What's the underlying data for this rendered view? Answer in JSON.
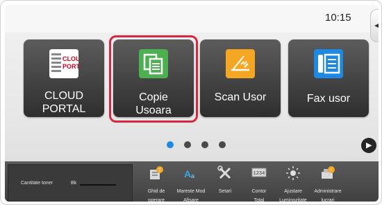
{
  "status": {
    "time": "10:15",
    "side_tab_icon": "collapse-arrow"
  },
  "tiles": [
    {
      "label": "CLOUD PORTAL",
      "icon": "cloud-portal-icon",
      "logo_lines": [
        "CLOUD",
        "PORTAL"
      ]
    },
    {
      "label_lines": [
        "Copie",
        "Usoara"
      ],
      "icon": "copy-icon",
      "color": "#4caf50",
      "selected": true
    },
    {
      "label": "Scan Usor",
      "icon": "scan-icon",
      "color": "#f5a623"
    },
    {
      "label": "Fax usor",
      "icon": "fax-icon",
      "color": "#1e88e5"
    }
  ],
  "pager": {
    "page_count": 4,
    "active_page": 1,
    "next_icon": "play-right-icon"
  },
  "taskbar": {
    "toner": {
      "label": "Cantitate toner",
      "color_code": "Bk"
    },
    "items": [
      {
        "label_lines": [
          "Ghid de",
          "operare"
        ],
        "icon": "operation-guide-icon"
      },
      {
        "label_lines": [
          "Mareste Mod",
          "Afisare"
        ],
        "icon": "enlarge-display-icon"
      },
      {
        "label_lines": [
          "Setari"
        ],
        "icon": "settings-icon"
      },
      {
        "label_lines": [
          "Contor",
          "Total"
        ],
        "icon": "total-count-icon"
      },
      {
        "label_lines": [
          "Ajustare",
          "Luminozitate"
        ],
        "icon": "brightness-icon"
      },
      {
        "label_lines": [
          "Administrare",
          "lucrari"
        ],
        "icon": "job-status-icon"
      }
    ]
  }
}
